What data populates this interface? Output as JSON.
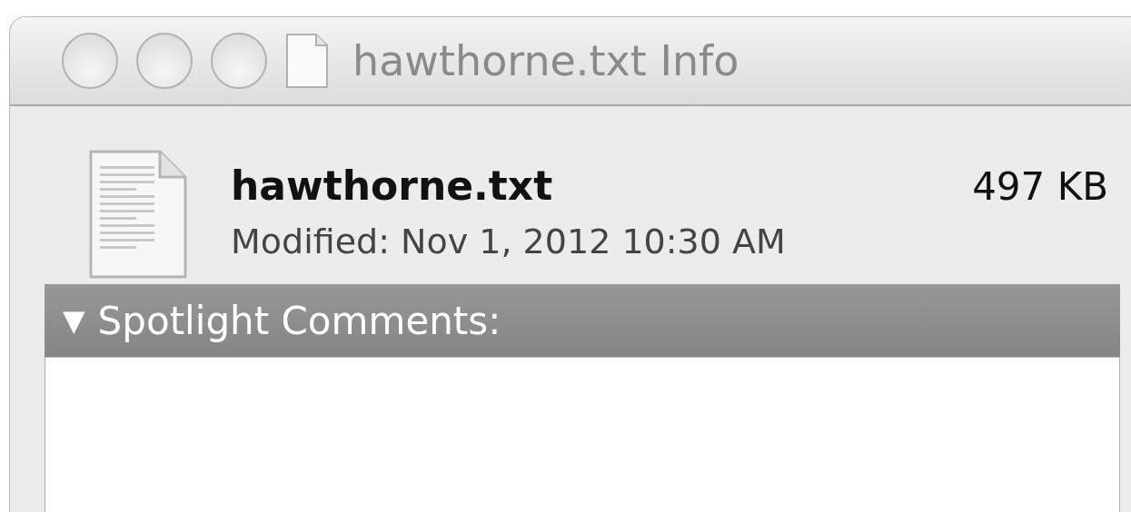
{
  "window": {
    "title": "hawthorne.txt Info"
  },
  "file": {
    "name": "hawthorne.txt",
    "size": "497 KB",
    "modified": "Modified: Nov 1, 2012 10:30 AM"
  },
  "section": {
    "toggle": "▼",
    "label": "Spotlight Comments:",
    "expanded": true
  }
}
